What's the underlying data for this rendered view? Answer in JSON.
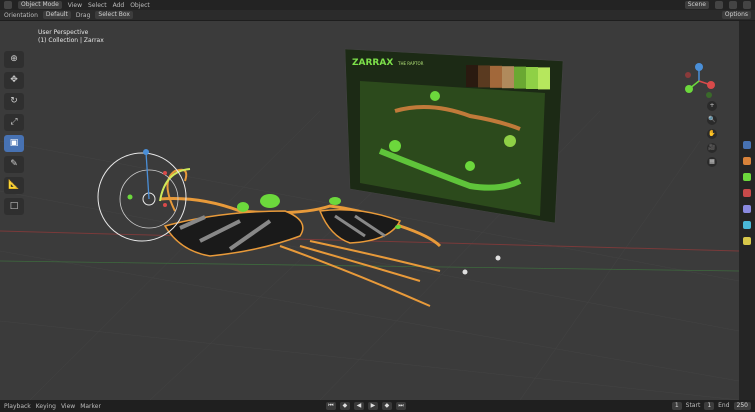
{
  "menu": {
    "workspace": "Object Mode",
    "items": [
      "View",
      "Select",
      "Add",
      "Object"
    ],
    "right_label": "Scene"
  },
  "toolbar2": {
    "orientation": "Orientation",
    "orientation_value": "Default",
    "drag": "Drag",
    "drag_value": "Select Box",
    "options": "Options"
  },
  "viewport": {
    "overlay_line1": "User Perspective",
    "overlay_line2": "(1) Collection | Zarrax"
  },
  "poster": {
    "title": "ZARRAX",
    "subtitle": "THE RAPTOR",
    "swatches": [
      "#2a1a10",
      "#5a3a20",
      "#a2683a",
      "#b08a5c",
      "#6aa832",
      "#8fd046",
      "#b6e75d"
    ]
  },
  "tools": [
    {
      "name": "cursor",
      "glyph": "⊕"
    },
    {
      "name": "move",
      "glyph": "✥"
    },
    {
      "name": "rotate",
      "glyph": "↻"
    },
    {
      "name": "scale",
      "glyph": "⤢"
    },
    {
      "name": "transform",
      "glyph": "▣"
    },
    {
      "name": "annotate",
      "glyph": "✎"
    },
    {
      "name": "measure",
      "glyph": "📐"
    },
    {
      "name": "add-cube",
      "glyph": "□"
    }
  ],
  "nav": [
    "+",
    "🔍",
    "✋",
    "🎥",
    "▦"
  ],
  "timeline": {
    "playback": "Playback",
    "keying": "Keying",
    "view": "View",
    "marker": "Marker",
    "frame": "1",
    "start_label": "Start",
    "start": "1",
    "end_label": "End",
    "end": "250"
  },
  "colors": {
    "accent": "#4772b3",
    "orange": "#e89a3a",
    "green": "#6cd83c"
  }
}
